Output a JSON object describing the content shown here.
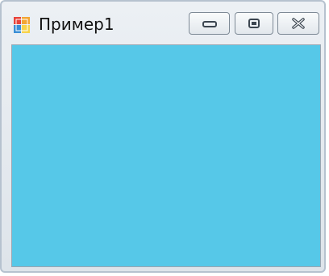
{
  "window": {
    "title": "Пример1",
    "icon": "app-window-icon",
    "buttons": {
      "minimize": "minimize-icon",
      "maximize": "maximize-icon",
      "close": "close-icon"
    }
  },
  "colors": {
    "client_background": "#56c8e8",
    "titlebar_background": "#e6ebf0"
  }
}
